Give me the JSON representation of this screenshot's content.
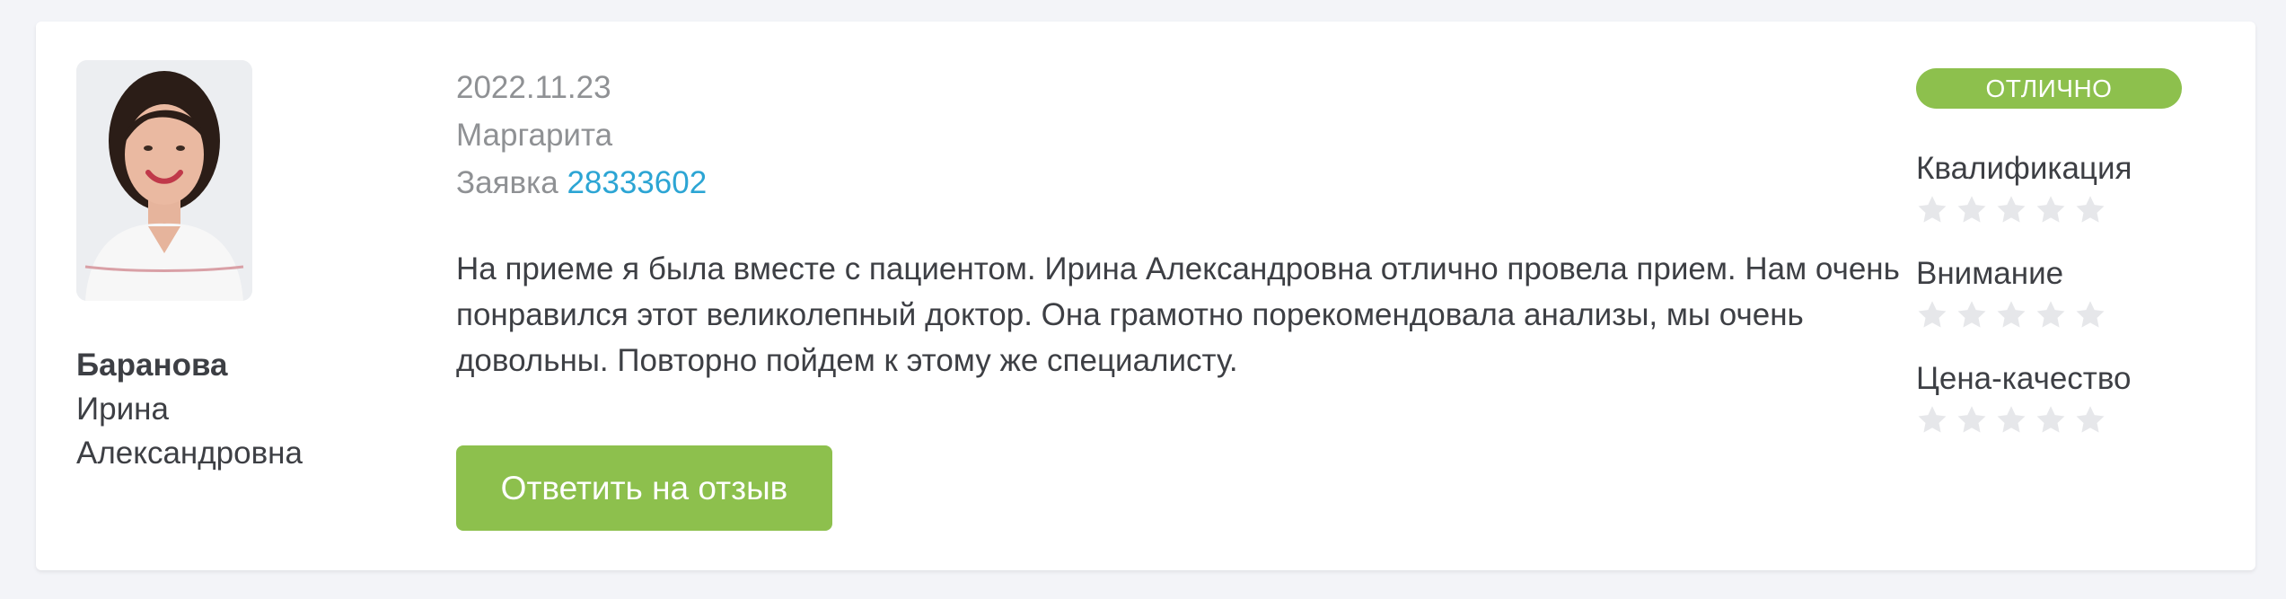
{
  "doctor": {
    "surname": "Баранова",
    "first_name": "Ирина",
    "patronymic": "Александровна"
  },
  "review": {
    "date": "2022.11.23",
    "author": "Маргарита",
    "request_label": "Заявка",
    "request_number": "28333602",
    "text": "На приеме я была вместе с пациентом. Ирина Александровна отлично провела прием. Нам очень понравился этот великолепный доктор. Она грамотно порекомендовала анализы, мы очень довольны. Повторно пойдем к этому же специалисту."
  },
  "actions": {
    "reply_label": "Ответить на отзыв"
  },
  "rating": {
    "overall_label": "ОТЛИЧНО",
    "criteria": [
      {
        "label": "Квалификация",
        "stars_filled": 0,
        "stars_total": 5
      },
      {
        "label": "Внимание",
        "stars_filled": 0,
        "stars_total": 5
      },
      {
        "label": "Цена-качество",
        "stars_filled": 0,
        "stars_total": 5
      }
    ]
  },
  "colors": {
    "accent_green": "#8dc04d",
    "link_blue": "#2ca5d4",
    "muted_text": "#8f9194",
    "body_text": "#3d3f44",
    "star_empty": "#e6e7ea",
    "page_background": "#f3f4f8"
  },
  "icons": {
    "star": "star-icon"
  }
}
